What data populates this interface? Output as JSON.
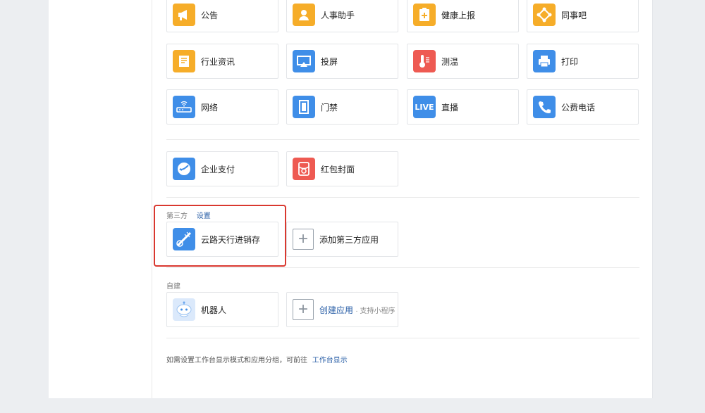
{
  "apps": {
    "row1": [
      {
        "name": "公告",
        "icon": "megaphone-icon",
        "color": "#f6ad29"
      },
      {
        "name": "人事助手",
        "icon": "person-icon",
        "color": "#f6ad29"
      },
      {
        "name": "健康上报",
        "icon": "health-report-icon",
        "color": "#f6ad29"
      },
      {
        "name": "同事吧",
        "icon": "network-diamond-icon",
        "color": "#f6ad29"
      }
    ],
    "row2": [
      {
        "name": "行业资讯",
        "icon": "news-icon",
        "color": "#f6ad29"
      },
      {
        "name": "投屏",
        "icon": "screen-cast-icon",
        "color": "#3f8ee8"
      },
      {
        "name": "测温",
        "icon": "thermometer-icon",
        "color": "#ee5a52"
      },
      {
        "name": "打印",
        "icon": "printer-icon",
        "color": "#3f8ee8"
      }
    ],
    "row3": [
      {
        "name": "网络",
        "icon": "router-icon",
        "color": "#3f8ee8"
      },
      {
        "name": "门禁",
        "icon": "door-icon",
        "color": "#3f8ee8"
      },
      {
        "name": "直播",
        "icon": "live-icon",
        "color": "#3f8ee8",
        "badge": "LIVE"
      },
      {
        "name": "公费电话",
        "icon": "phone-icon",
        "color": "#3f8ee8"
      }
    ],
    "pay": [
      {
        "name": "企业支付",
        "icon": "payment-icon",
        "color": "#3f8ee8"
      },
      {
        "name": "红包封面",
        "icon": "red-packet-icon",
        "color": "#ee5a52"
      }
    ]
  },
  "third_party": {
    "title": "第三方",
    "settings_link": "设置",
    "app": {
      "name": "云路天行进销存",
      "icon": "yunlu-app-icon",
      "color": "#3f8ee8"
    },
    "add_label": "添加第三方应用"
  },
  "self_built": {
    "title": "自建",
    "app": {
      "name": "机器人",
      "icon": "robot-icon"
    },
    "create_label": "创建应用",
    "create_suffix": "· 支持小程序"
  },
  "footer": {
    "note": "如需设置工作台显示模式和应用分组，可前往",
    "link": "工作台显示"
  }
}
